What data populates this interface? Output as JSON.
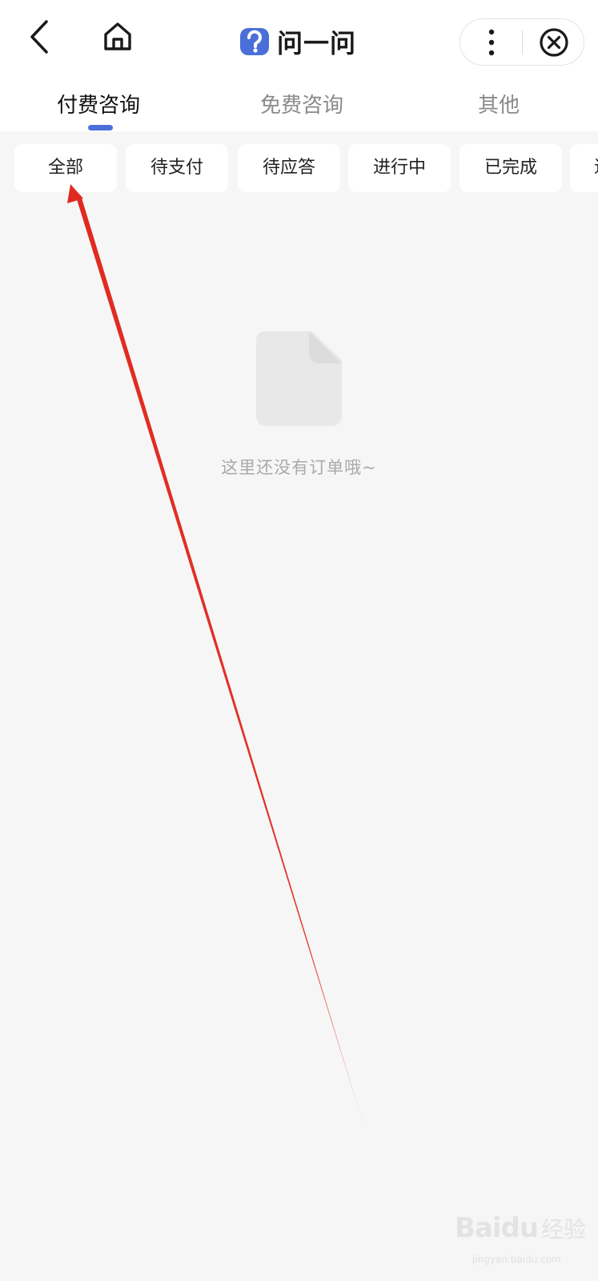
{
  "header": {
    "app_name": "问一问",
    "icons": {
      "back": "chevron-left-icon",
      "home": "home-icon",
      "more": "more-vertical-icon",
      "close": "close-circle-icon"
    }
  },
  "tabs": [
    {
      "label": "付费咨询",
      "active": true
    },
    {
      "label": "免费咨询",
      "active": false
    },
    {
      "label": "其他",
      "active": false
    }
  ],
  "filters": [
    {
      "label": "全部",
      "active": true
    },
    {
      "label": "待支付",
      "active": false
    },
    {
      "label": "待应答",
      "active": false
    },
    {
      "label": "进行中",
      "active": false
    },
    {
      "label": "已完成",
      "active": false
    },
    {
      "label": "退",
      "active": false
    }
  ],
  "empty_state": {
    "icon": "document-icon",
    "message": "这里还没有订单哦~"
  },
  "annotation": {
    "color": "#e02a20"
  },
  "watermark": {
    "brand": "Baidu",
    "label": "经验",
    "url": "jingyan.baidu.com"
  },
  "colors": {
    "accent": "#4b6fd8",
    "background": "#f6f6f6"
  }
}
